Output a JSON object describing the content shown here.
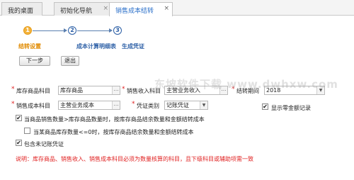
{
  "tabs": [
    {
      "label": "我的桌面"
    },
    {
      "label": "初始化导航",
      "close": "×"
    },
    {
      "label": "销售成本结转",
      "close": "×"
    }
  ],
  "steps": [
    {
      "number": "1",
      "label": "结转设置",
      "state": "active"
    },
    {
      "number": "2",
      "label": "成本计算明细表",
      "state": "pending"
    },
    {
      "number": "3",
      "label": "生成凭证",
      "state": "pending"
    }
  ],
  "buttons": {
    "next": "下一步",
    "exit": "退出"
  },
  "form": {
    "required_mark": "*",
    "inventory_subject": {
      "label": "库存商品科目",
      "value": "库存商品"
    },
    "revenue_subject": {
      "label": "销售收入科目",
      "value": "主营业务收入"
    },
    "carry_period": {
      "label": "结转期间",
      "value": "2018"
    },
    "cost_subject": {
      "label": "销售成本科目",
      "value": "主营业务成本"
    },
    "voucher_type": {
      "label": "凭证类别",
      "value": "记账凭证"
    },
    "show_zero": {
      "label": "显示零金额记录",
      "checked": true
    },
    "option_qty_greater": {
      "label": "当商品销售数量>库存商品数量时，按库存商品结余数量和金额结转成本",
      "checked": true
    },
    "option_stock_zero": {
      "label": "当某商品库存数量<=0时，按库存商品结余数量和金额结转成本",
      "checked": false
    },
    "include_unposted": {
      "label": "包含未记账凭证",
      "checked": true
    }
  },
  "note": "说明：库存商品、销售收入、销售成本科目必须为数量核算的科目，且下级科目或辅助项需一致",
  "watermark": "东坡软件下载 www.dwhxw.com",
  "icons": {
    "check": "✔",
    "caret": "▼",
    "ellipsis": "…"
  },
  "colors": {
    "accent": "#2a6fc9",
    "warning": "#e02020",
    "step_active": "#f3b33d"
  }
}
